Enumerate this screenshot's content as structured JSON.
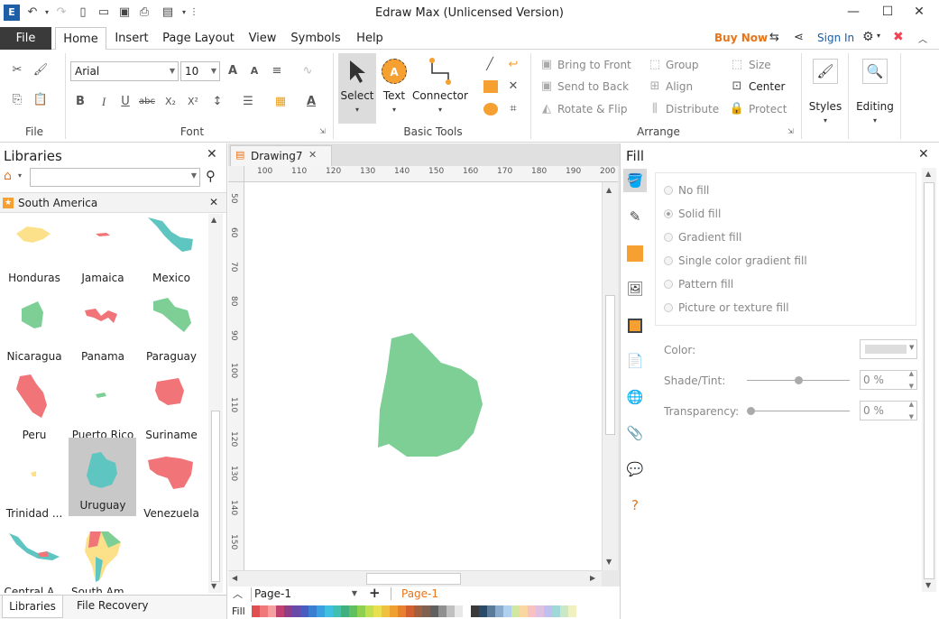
{
  "app": {
    "title": "Edraw Max (Unlicensed Version)"
  },
  "menu": {
    "file": "File",
    "tabs": [
      "Home",
      "Insert",
      "Page Layout",
      "View",
      "Symbols",
      "Help"
    ],
    "buy_now": "Buy Now",
    "sign_in": "Sign In"
  },
  "ribbon": {
    "file_group": "File",
    "font_group": "Font",
    "font_name": "Arial",
    "font_size": "10",
    "basic_tools_group": "Basic Tools",
    "select": "Select",
    "text": "Text",
    "connector": "Connector",
    "arrange_group": "Arrange",
    "bring_to_front": "Bring to Front",
    "send_to_back": "Send to Back",
    "rotate_flip": "Rotate & Flip",
    "group": "Group",
    "align": "Align",
    "distribute": "Distribute",
    "size": "Size",
    "center": "Center",
    "protect": "Protect",
    "styles": "Styles",
    "editing": "Editing"
  },
  "libraries": {
    "title": "Libraries",
    "category": "South America",
    "items": [
      {
        "label": "Honduras",
        "color": "#fde08a"
      },
      {
        "label": "Jamaica",
        "color": "#f07478"
      },
      {
        "label": "Mexico",
        "color": "#5fc5c0"
      },
      {
        "label": "Nicaragua",
        "color": "#7dcf96"
      },
      {
        "label": "Panama",
        "color": "#f07478"
      },
      {
        "label": "Paraguay",
        "color": "#7dcf96"
      },
      {
        "label": "Peru",
        "color": "#f07478"
      },
      {
        "label": "Puerto Rico",
        "color": "#7dcf96"
      },
      {
        "label": "Suriname",
        "color": "#f07478"
      },
      {
        "label": "Trinidad ...",
        "color": "#fde08a"
      },
      {
        "label": "Uruguay",
        "color": "#5fc5c0"
      },
      {
        "label": "Venezuela",
        "color": "#f07478"
      },
      {
        "label": "Central A...",
        "color": "#5fc5c0"
      },
      {
        "label": "South Am...",
        "color": "#f4a460"
      }
    ],
    "bottom_tabs": [
      "Libraries",
      "File Recovery"
    ]
  },
  "document": {
    "tab": "Drawing7",
    "ruler_h": [
      "100",
      "110",
      "120",
      "130",
      "140",
      "150",
      "160",
      "170",
      "180",
      "190",
      "200"
    ],
    "ruler_v": [
      "50",
      "60",
      "70",
      "80",
      "90",
      "100",
      "110",
      "120",
      "130",
      "140",
      "150"
    ],
    "shape_color": "#7dcf96",
    "page_select": "Page-1",
    "page_tab": "Page-1",
    "fill_label": "Fill"
  },
  "fill_panel": {
    "title": "Fill",
    "options": [
      "No fill",
      "Solid fill",
      "Gradient fill",
      "Single color gradient fill",
      "Pattern fill",
      "Picture or texture fill"
    ],
    "color_label": "Color:",
    "shade_label": "Shade/Tint:",
    "shade_value": "0 %",
    "transparency_label": "Transparency:",
    "transparency_value": "0 %"
  }
}
